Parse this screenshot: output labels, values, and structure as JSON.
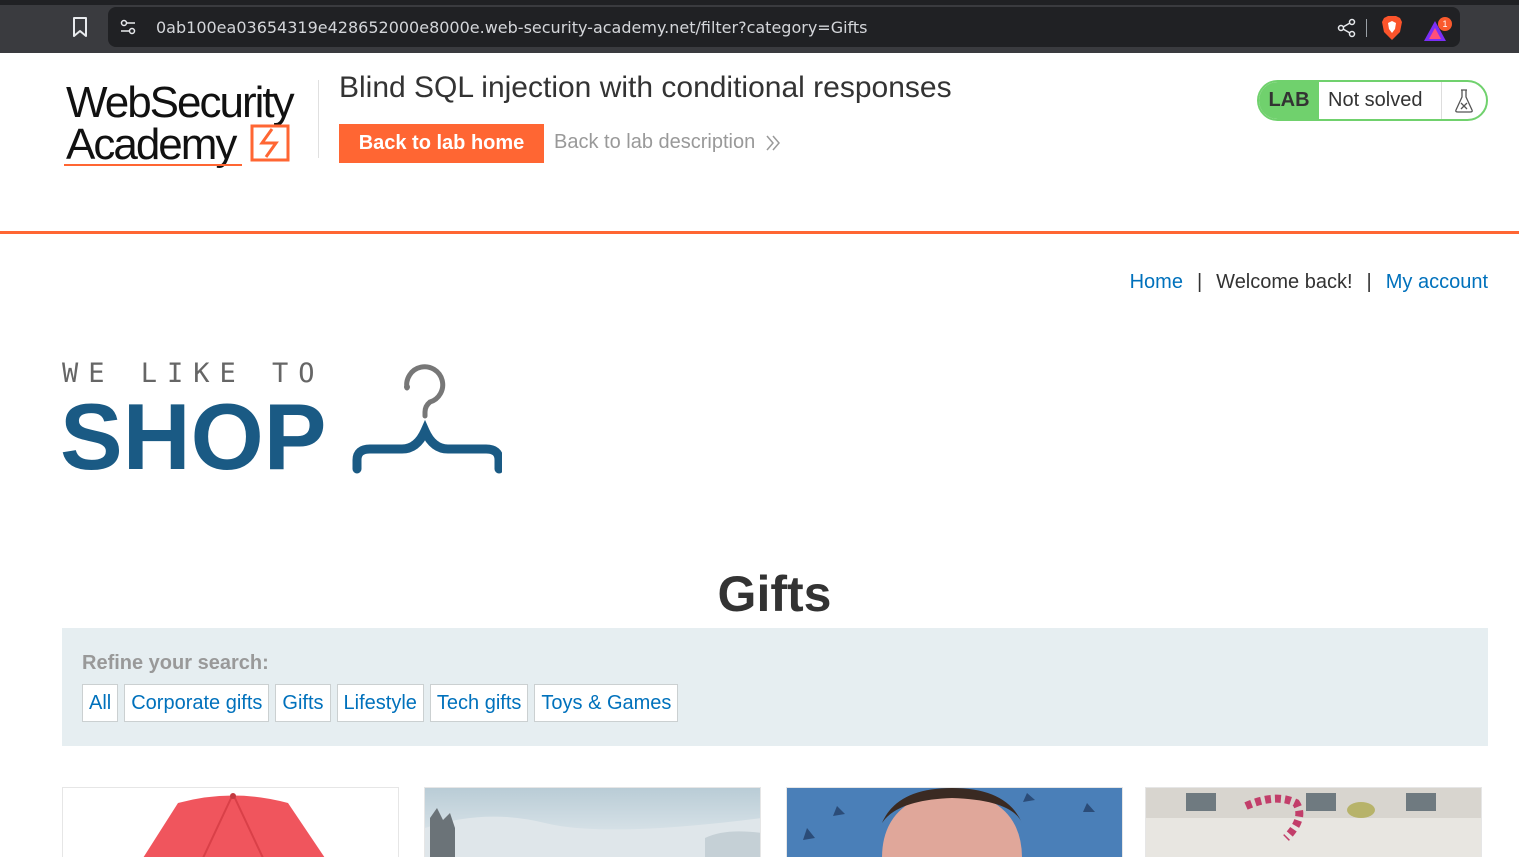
{
  "browser": {
    "url": "0ab100ea03654319e428652000e8000e.web-security-academy.net/filter?category=Gifts",
    "rewards_count": "1"
  },
  "lab": {
    "logo_line1": "WebSecurity",
    "logo_line2": "Academy",
    "title": "Blind SQL injection with conditional responses",
    "back_home": "Back to lab home",
    "back_description": "Back to lab description",
    "badge": "LAB",
    "status": "Not solved"
  },
  "nav": {
    "home": "Home",
    "sep1": "|",
    "welcome": "Welcome back!",
    "sep2": "|",
    "my_account": "My account"
  },
  "shop_logo": {
    "tagline": "WE LIKE TO",
    "word": "SHOP"
  },
  "page_heading": "Gifts",
  "filter": {
    "label": "Refine your search:",
    "categories": [
      "All",
      "Corporate gifts",
      "Gifts",
      "Lifestyle",
      "Tech gifts",
      "Toys & Games"
    ]
  },
  "colors": {
    "brand_orange": "#ff6633",
    "link_blue": "#0071bc",
    "lab_green": "#70d16d",
    "shop_blue": "#1a5a84"
  }
}
